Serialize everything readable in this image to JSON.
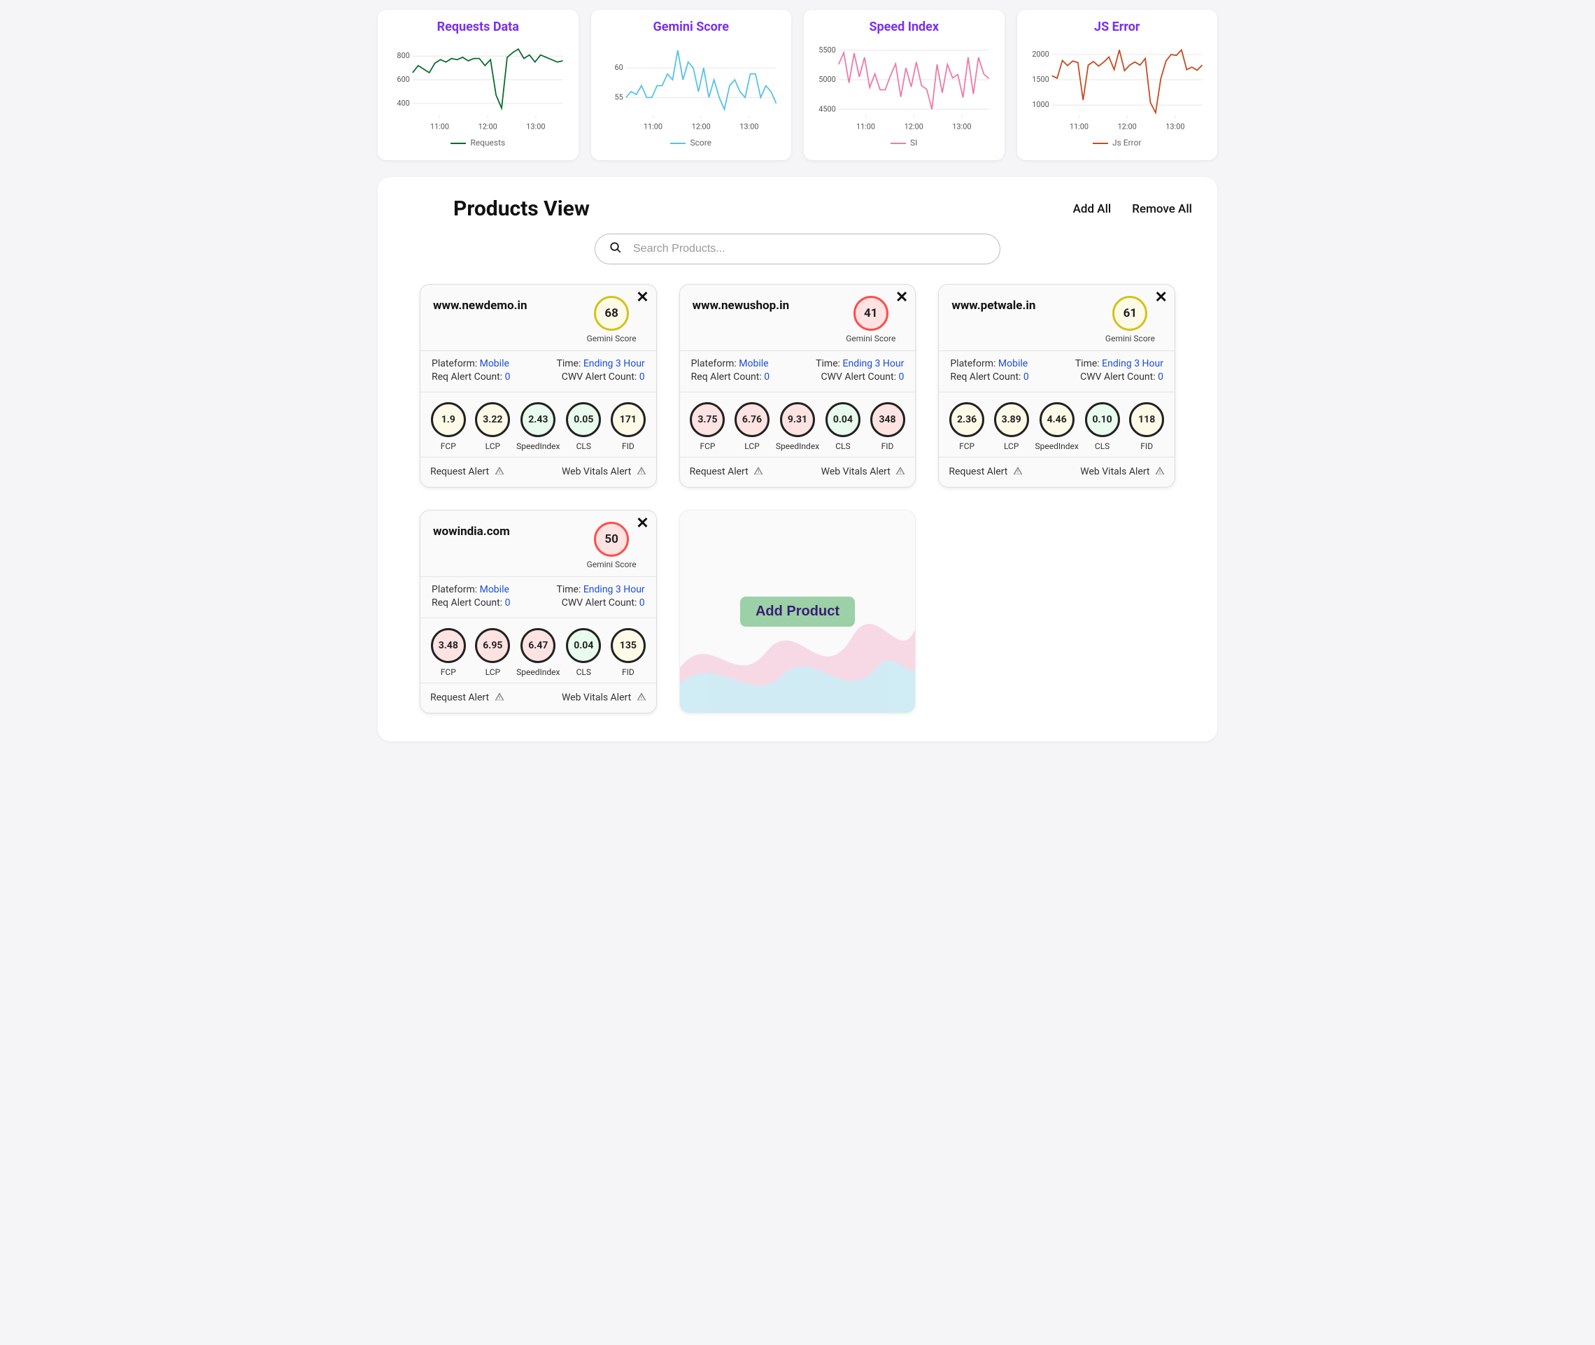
{
  "chart_data": [
    {
      "id": "requests",
      "type": "line",
      "title": "Requests Data",
      "legend": "Requests",
      "color": "#0b6b2d",
      "yticks": [
        400,
        600,
        800
      ],
      "xticks": [
        "11:00",
        "12:00",
        "13:00"
      ],
      "ylim": [
        300,
        900
      ],
      "values": [
        660,
        720,
        690,
        660,
        740,
        770,
        750,
        780,
        770,
        790,
        760,
        780,
        780,
        720,
        770,
        470,
        360,
        790,
        830,
        860,
        780,
        810,
        750,
        810,
        790,
        770,
        750,
        760
      ]
    },
    {
      "id": "gemini",
      "type": "line",
      "title": "Gemini Score",
      "legend": "Score",
      "color": "#56c2e6",
      "yticks": [
        55,
        60
      ],
      "xticks": [
        "11:00",
        "12:00",
        "13:00"
      ],
      "ylim": [
        52,
        64
      ],
      "values": [
        55,
        56,
        55.5,
        57,
        55,
        55,
        57,
        57,
        59,
        58,
        63,
        58,
        61,
        60,
        56,
        60,
        55,
        58,
        55,
        53,
        57,
        58,
        56,
        55,
        59,
        59,
        55,
        57,
        56,
        54
      ]
    },
    {
      "id": "speed",
      "type": "line",
      "title": "Speed Index",
      "legend": "SI",
      "color": "#ef7aa8",
      "yticks": [
        4500,
        5000,
        5500
      ],
      "xticks": [
        "11:00",
        "12:00",
        "13:00"
      ],
      "ylim": [
        4400,
        5600
      ],
      "values": [
        5260,
        5460,
        4950,
        5450,
        5050,
        5380,
        4870,
        5100,
        4830,
        4830,
        5070,
        5270,
        4710,
        5200,
        4880,
        5300,
        4900,
        4840,
        4500,
        5260,
        4780,
        5260,
        5030,
        5090,
        4700,
        5380,
        4760,
        5380,
        5100,
        5020
      ]
    },
    {
      "id": "jserror",
      "type": "line",
      "title": "JS Error",
      "legend": "Js Error",
      "color": "#c44b1f",
      "yticks": [
        1000,
        1500,
        2000
      ],
      "xticks": [
        "11:00",
        "12:00",
        "13:00"
      ],
      "ylim": [
        800,
        2200
      ],
      "values": [
        1580,
        1530,
        1880,
        1780,
        1870,
        1840,
        1100,
        1790,
        1860,
        1770,
        1850,
        1950,
        1700,
        2090,
        1680,
        1790,
        1850,
        1790,
        1920,
        1050,
        850,
        1520,
        1870,
        2000,
        1980,
        2090,
        1700,
        1750,
        1690,
        1790
      ]
    }
  ],
  "panel": {
    "title": "Products View",
    "add_all": "Add All",
    "remove_all": "Remove All",
    "search_placeholder": "Search Products...",
    "add_product_label": "Add Product",
    "labels": {
      "gemini_score": "Gemini Score",
      "platform_label": "Plateform:",
      "time_label": "Time:",
      "req_alert_label": "Req Alert Count:",
      "cwv_alert_label": "CWV Alert Count:",
      "request_alert": "Request Alert",
      "web_vitals_alert": "Web Vitals Alert",
      "metrics": [
        "FCP",
        "LCP",
        "SpeedIndex",
        "CLS",
        "FID"
      ]
    }
  },
  "products": [
    {
      "domain": "www.newdemo.in",
      "score": 68,
      "score_class": "yellow",
      "platform": "Mobile",
      "time": "Ending 3 Hour",
      "req_alert_count": 0,
      "cwv_alert_count": 0,
      "metrics": [
        {
          "v": "1.9",
          "c": "yellow"
        },
        {
          "v": "3.22",
          "c": "yellow"
        },
        {
          "v": "2.43",
          "c": "green"
        },
        {
          "v": "0.05",
          "c": "green"
        },
        {
          "v": "171",
          "c": "yellow"
        }
      ]
    },
    {
      "domain": "www.newushop.in",
      "score": 41,
      "score_class": "red",
      "platform": "Mobile",
      "time": "Ending 3 Hour",
      "req_alert_count": 0,
      "cwv_alert_count": 0,
      "metrics": [
        {
          "v": "3.75",
          "c": "red"
        },
        {
          "v": "6.76",
          "c": "red"
        },
        {
          "v": "9.31",
          "c": "red"
        },
        {
          "v": "0.04",
          "c": "green"
        },
        {
          "v": "348",
          "c": "red"
        }
      ]
    },
    {
      "domain": "www.petwale.in",
      "score": 61,
      "score_class": "yellow",
      "platform": "Mobile",
      "time": "Ending 3 Hour",
      "req_alert_count": 0,
      "cwv_alert_count": 0,
      "metrics": [
        {
          "v": "2.36",
          "c": "yellow"
        },
        {
          "v": "3.89",
          "c": "yellow"
        },
        {
          "v": "4.46",
          "c": "yellow"
        },
        {
          "v": "0.10",
          "c": "green"
        },
        {
          "v": "118",
          "c": "yellow"
        }
      ]
    },
    {
      "domain": "wowindia.com",
      "score": 50,
      "score_class": "red",
      "platform": "Mobile",
      "time": "Ending 3 Hour",
      "req_alert_count": 0,
      "cwv_alert_count": 0,
      "metrics": [
        {
          "v": "3.48",
          "c": "red"
        },
        {
          "v": "6.95",
          "c": "red"
        },
        {
          "v": "6.47",
          "c": "red"
        },
        {
          "v": "0.04",
          "c": "green"
        },
        {
          "v": "135",
          "c": "yellow"
        }
      ]
    }
  ]
}
